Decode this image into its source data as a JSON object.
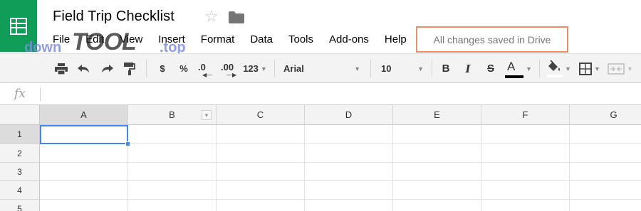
{
  "document": {
    "title": "Field Trip Checklist",
    "save_status": "All changes saved in Drive"
  },
  "watermark": {
    "part1": "down",
    "part2": "TOOL",
    "part3": ".top"
  },
  "menu": [
    "File",
    "Edit",
    "View",
    "Insert",
    "Format",
    "Data",
    "Tools",
    "Add-ons",
    "Help"
  ],
  "toolbar": {
    "currency": "$",
    "percent": "%",
    "decrease_decimal": ".0",
    "increase_decimal": ".00",
    "more_formats": "123",
    "font": "Arial",
    "font_size": "10",
    "bold": "B",
    "italic": "I",
    "strike": "S",
    "text_color": "A"
  },
  "formula_bar": {
    "fx": "fx",
    "value": ""
  },
  "sheet": {
    "columns": [
      "A",
      "B",
      "C",
      "D",
      "E",
      "F",
      "G"
    ],
    "rows": [
      "1",
      "2",
      "3",
      "4",
      "5"
    ],
    "selected_cell": "A1"
  },
  "colors": {
    "brand_green": "#0f9d58",
    "selection_blue": "#4285f4",
    "highlight_orange": "#ee8d63",
    "text_color_bar": "#000000"
  }
}
